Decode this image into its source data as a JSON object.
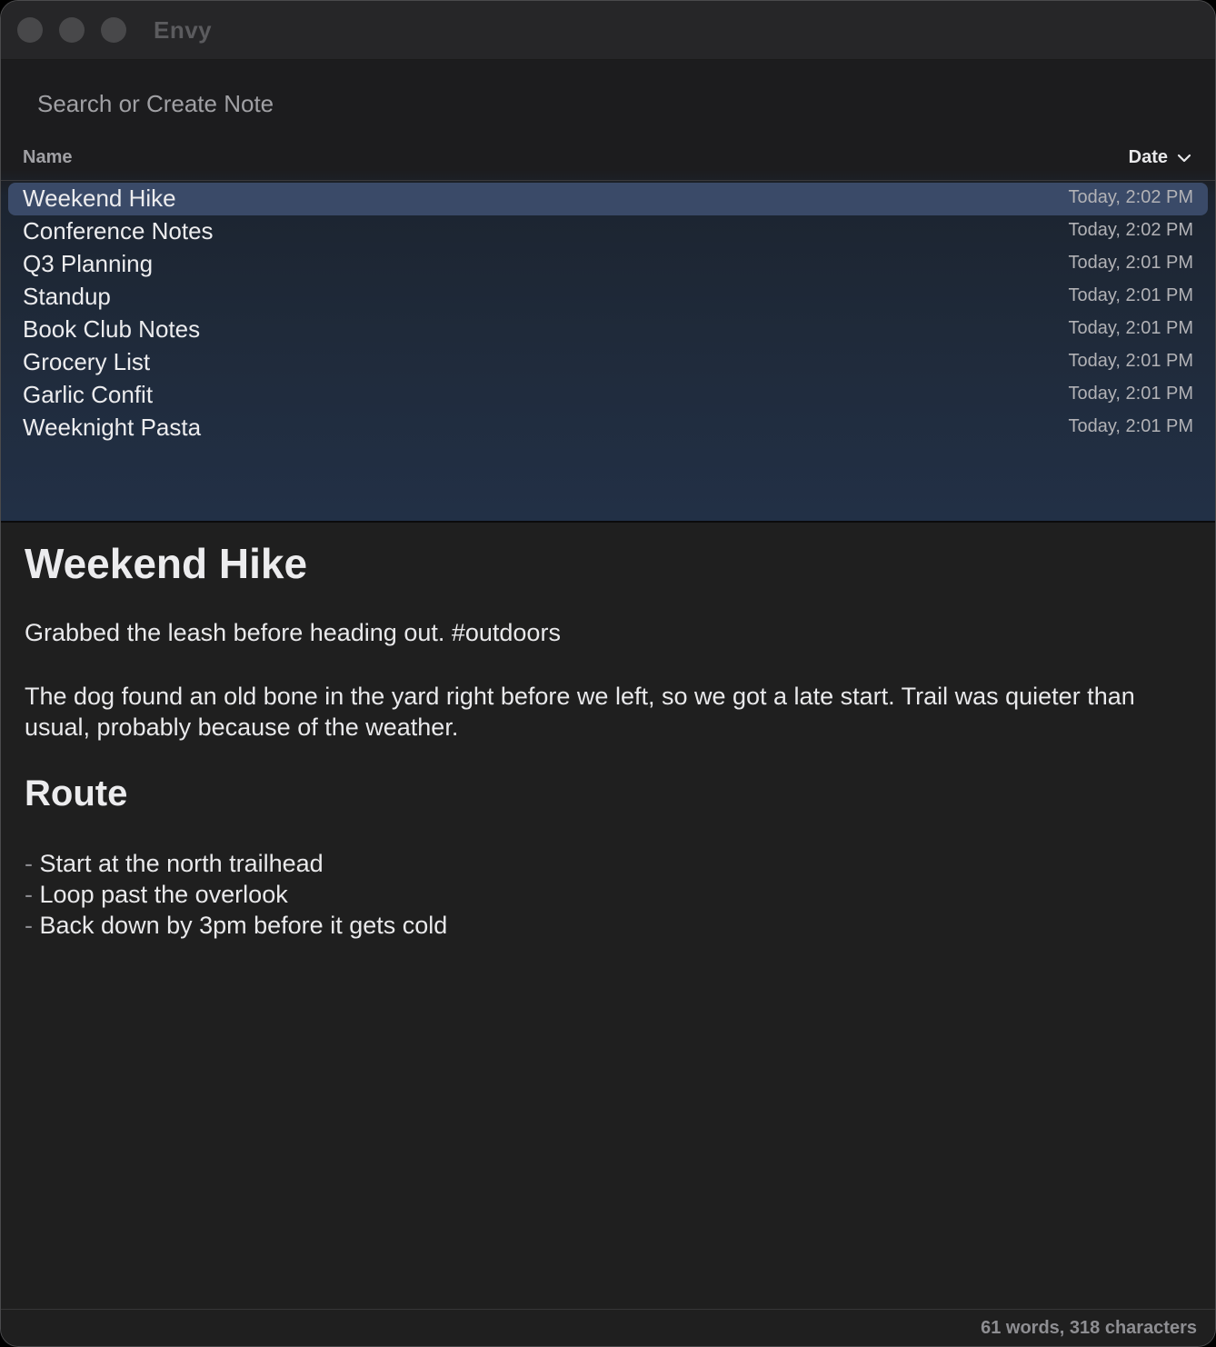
{
  "window": {
    "title": "Envy"
  },
  "search": {
    "placeholder": "Search or Create Note"
  },
  "columns": {
    "name": "Name",
    "date": "Date"
  },
  "notes": [
    {
      "title": "Weekend Hike",
      "date": "Today, 2:02 PM",
      "selected": true
    },
    {
      "title": "Conference Notes",
      "date": "Today, 2:02 PM"
    },
    {
      "title": "Q3 Planning",
      "date": "Today, 2:01 PM"
    },
    {
      "title": "Standup",
      "date": "Today, 2:01 PM"
    },
    {
      "title": "Book Club Notes",
      "date": "Today, 2:01 PM"
    },
    {
      "title": "Grocery List",
      "date": "Today, 2:01 PM"
    },
    {
      "title": "Garlic Confit",
      "date": "Today, 2:01 PM"
    },
    {
      "title": "Weeknight Pasta",
      "date": "Today, 2:01 PM"
    }
  ],
  "editor": {
    "heading": "Weekend Hike",
    "paragraph1": "Grabbed the leash before heading out. #outdoors",
    "paragraph2": "The dog found an old bone in the yard right before we left, so we got a late start. Trail was quieter than usual, probably because of the weather.",
    "subheading": "Route",
    "list": [
      "Start at the north trailhead",
      "Loop past the overlook",
      "Back down by 3pm before it gets cold"
    ],
    "list_marker": "-"
  },
  "status": {
    "text": "61 words, 318 characters"
  }
}
